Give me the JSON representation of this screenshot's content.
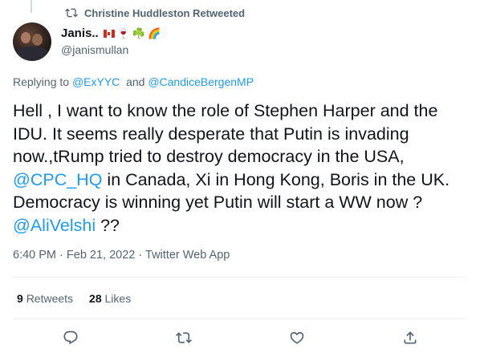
{
  "retweet_header": {
    "text": "Christine Huddleston Retweeted"
  },
  "author": {
    "name": "Janis..",
    "emojis": [
      "🍁",
      "🍷",
      "☘️",
      "🌈"
    ],
    "handle": "@janismullan"
  },
  "reply": {
    "prefix": "Replying to",
    "mention1": "@ExYYC",
    "conjunction": "and",
    "mention2": "@CandiceBergenMP"
  },
  "tweet": {
    "part1": "Hell , I want to know the role of Stephen Harper and the IDU. It seems really desperate that Putin is invading now.,tRump tried to destroy democracy in the USA, ",
    "mention_cpc": "@CPC_HQ",
    "part2": " in Canada, Xi in Hong Kong, Boris in the UK. Democracy is winning yet Putin will start a WW now ? ",
    "mention_ali": "@AliVelshi",
    "part3": " ??"
  },
  "meta": {
    "time": "6:40 PM",
    "separator": "·",
    "date": "Feb 21, 2022",
    "source": "Twitter Web App"
  },
  "stats": {
    "retweets_count": "9",
    "retweets_label": "Retweets",
    "likes_count": "28",
    "likes_label": "Likes"
  },
  "actions": [
    "reply-icon",
    "retweet-icon",
    "like-icon",
    "share-icon"
  ],
  "colors": {
    "link": "#1d9bf0",
    "secondary_text": "#536471",
    "primary_text": "#0f1419",
    "divider": "#eff3f4"
  }
}
